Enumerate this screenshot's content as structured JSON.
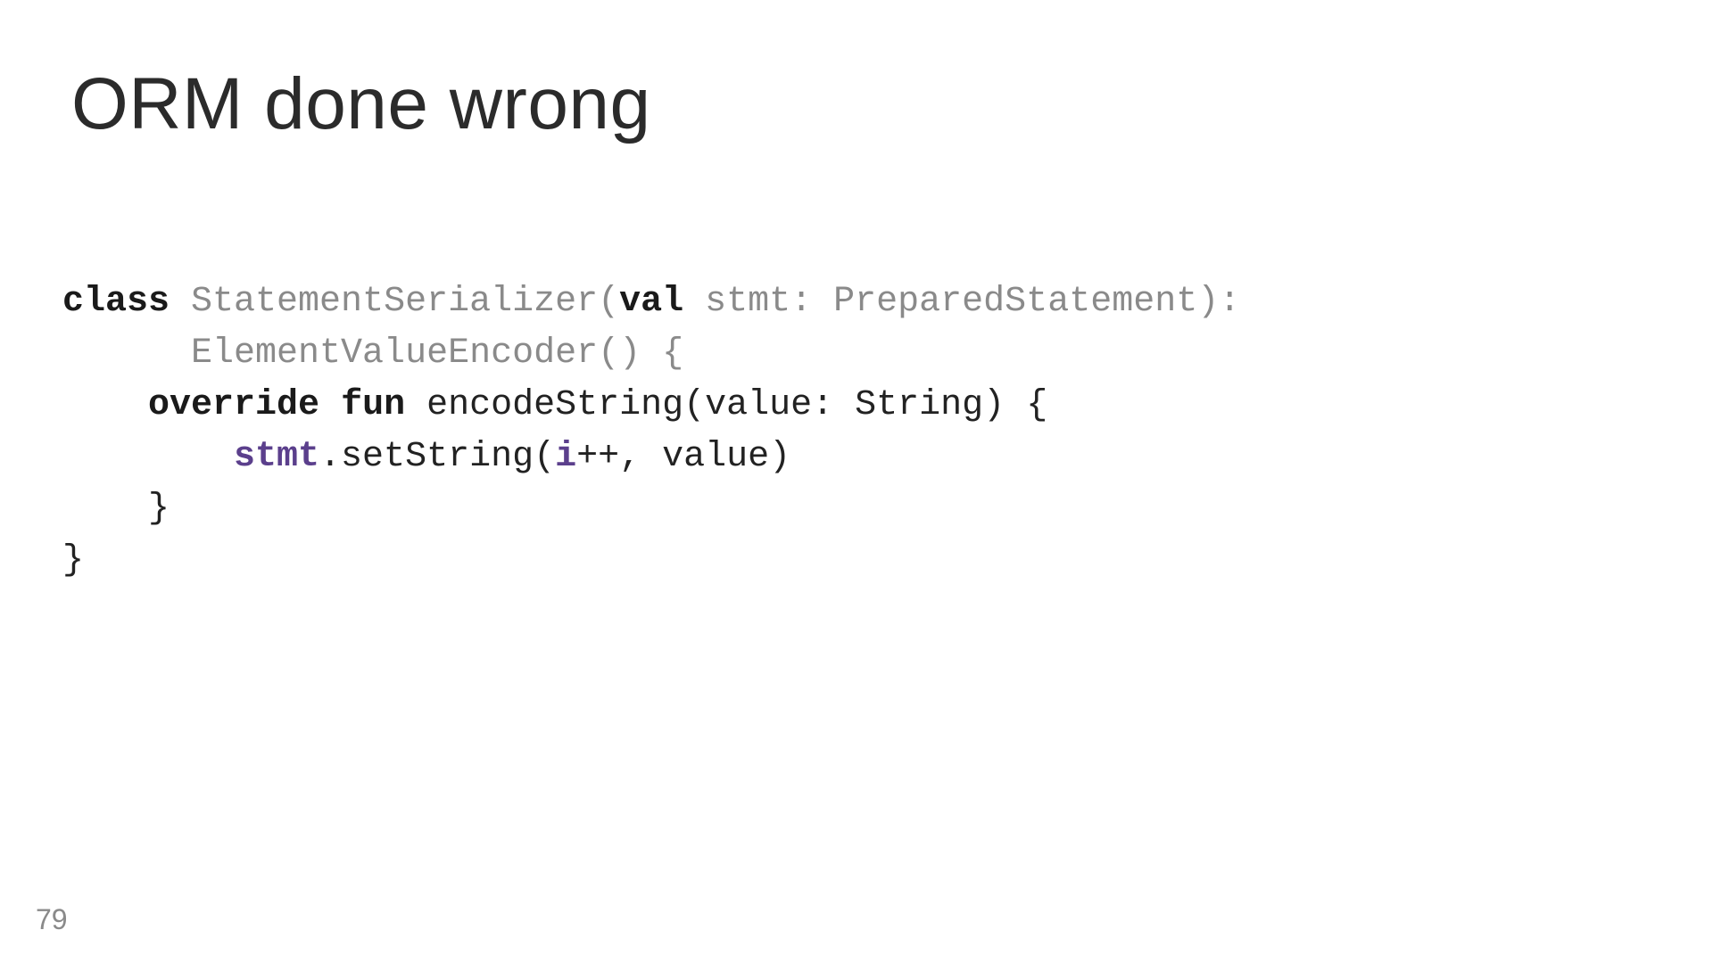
{
  "slide": {
    "title": "ORM done wrong",
    "page_number": "79",
    "code": {
      "l1_class": "class ",
      "l1_name": "StatementSerializer(",
      "l1_val": "val ",
      "l1_stmt": "stmt",
      "l1_rest": ": PreparedStatement):",
      "l2": "      ElementValueEncoder() {",
      "l3_indent": "    ",
      "l3_override": "override ",
      "l3_fun": "fun ",
      "l3_rest": "encodeString(value: String) {",
      "l4_indent": "        ",
      "l4_stmt": "stmt",
      "l4_mid": ".setString(",
      "l4_i": "i",
      "l4_rest": "++, value)",
      "l5": "    }",
      "l6": "}"
    }
  }
}
